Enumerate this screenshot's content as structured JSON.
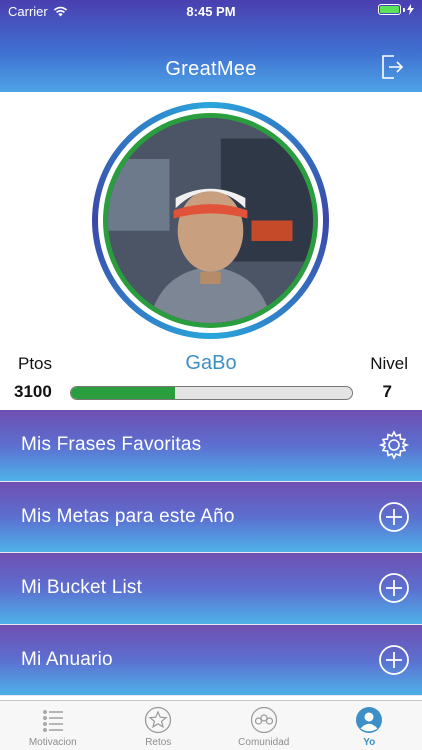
{
  "status_bar": {
    "carrier": "Carrier",
    "time": "8:45 PM"
  },
  "header": {
    "title": "GreatMee"
  },
  "profile": {
    "points_label": "Ptos",
    "username": "GaBo",
    "level_label": "Nivel",
    "points": "3100",
    "level": "7",
    "progress": 0.37
  },
  "menu": [
    {
      "label": "Mis Frases Favoritas",
      "icon": "gear-icon"
    },
    {
      "label": "Mis Metas para este Año",
      "icon": "plus-circle-icon"
    },
    {
      "label": "Mi Bucket List",
      "icon": "plus-circle-icon"
    },
    {
      "label": "Mi Anuario",
      "icon": "plus-circle-icon"
    }
  ],
  "tabbar": [
    {
      "label": "Motivacion",
      "icon": "list-icon",
      "active": false
    },
    {
      "label": "Retos",
      "icon": "star-icon",
      "active": false
    },
    {
      "label": "Comunidad",
      "icon": "community-icon",
      "active": false
    },
    {
      "label": "Yo",
      "icon": "user-icon",
      "active": true
    }
  ],
  "colors": {
    "accent": "#3d8fc7",
    "progress": "#2a9e3f",
    "header_top": "#4a3fb0",
    "header_bottom": "#4ea3e6"
  }
}
